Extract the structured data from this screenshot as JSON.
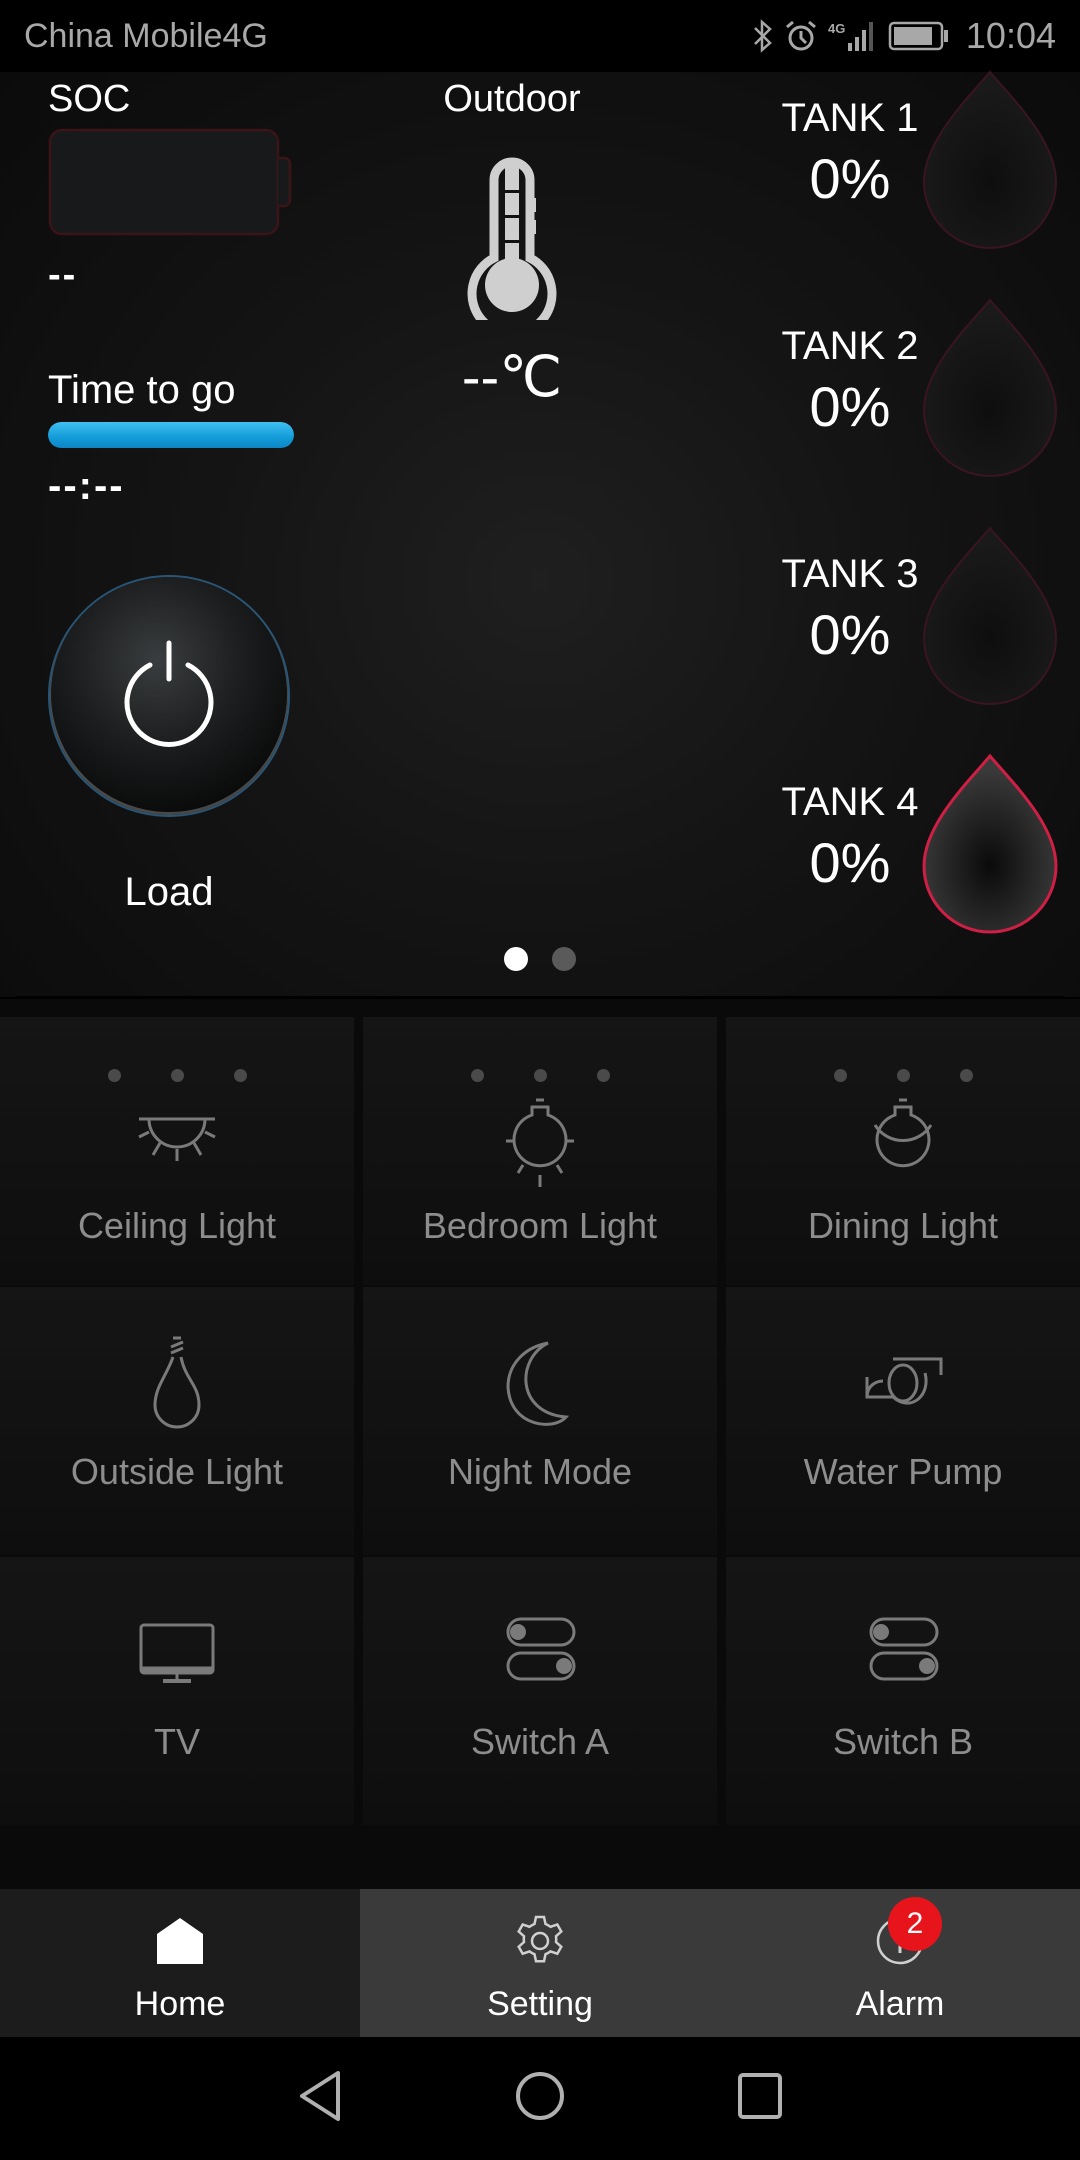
{
  "status_bar": {
    "carrier": "China Mobile4G",
    "network": "4G",
    "time": "10:04",
    "icons": [
      "bluetooth-icon",
      "alarm-clock-icon",
      "signal-icon",
      "battery-icon"
    ]
  },
  "dashboard": {
    "soc": {
      "label": "SOC",
      "value": "--",
      "level": 0
    },
    "time_to_go": {
      "label": "Time to go",
      "value": "--:--",
      "bar_fill_percent": 100,
      "bar_color": "#1aa3e0"
    },
    "load": {
      "label": "Load",
      "icon": "power-icon"
    },
    "outdoor": {
      "label": "Outdoor",
      "value": "--℃",
      "icon": "thermometer-icon"
    },
    "tanks": [
      {
        "name": "TANK 1",
        "value": "0%",
        "level": 0,
        "active": false
      },
      {
        "name": "TANK 2",
        "value": "0%",
        "level": 0,
        "active": false
      },
      {
        "name": "TANK 3",
        "value": "0%",
        "level": 0,
        "active": false
      },
      {
        "name": "TANK 4",
        "value": "0%",
        "level": 0,
        "active": true
      }
    ],
    "pager": {
      "pages": 2,
      "current": 1
    }
  },
  "devices": [
    {
      "label": "Ceiling Light",
      "icon": "ceiling-light-icon",
      "has_dots": true
    },
    {
      "label": "Bedroom Light",
      "icon": "bulb-icon",
      "has_dots": true
    },
    {
      "label": "Dining Light",
      "icon": "pendant-bulb-icon",
      "has_dots": true
    },
    {
      "label": "Outside Light",
      "icon": "outside-bulb-icon",
      "has_dots": false
    },
    {
      "label": "Night Mode",
      "icon": "moon-icon",
      "has_dots": false
    },
    {
      "label": "Water Pump",
      "icon": "pump-icon",
      "has_dots": false
    },
    {
      "label": "TV",
      "icon": "tv-icon",
      "has_dots": false
    },
    {
      "label": "Switch A",
      "icon": "toggle-switch-icon",
      "has_dots": false
    },
    {
      "label": "Switch B",
      "icon": "toggle-switch-icon",
      "has_dots": false
    }
  ],
  "bottom_nav": {
    "tabs": [
      {
        "label": "Home",
        "icon": "home-icon",
        "active": true
      },
      {
        "label": "Setting",
        "icon": "gear-icon",
        "active": false
      },
      {
        "label": "Alarm",
        "icon": "info-icon",
        "active": false
      }
    ],
    "alarm_badge": "2",
    "badge_color": "#e8141b"
  },
  "colors": {
    "tank_outline": "#d01f45",
    "accent_blue": "#1aa3e0"
  }
}
